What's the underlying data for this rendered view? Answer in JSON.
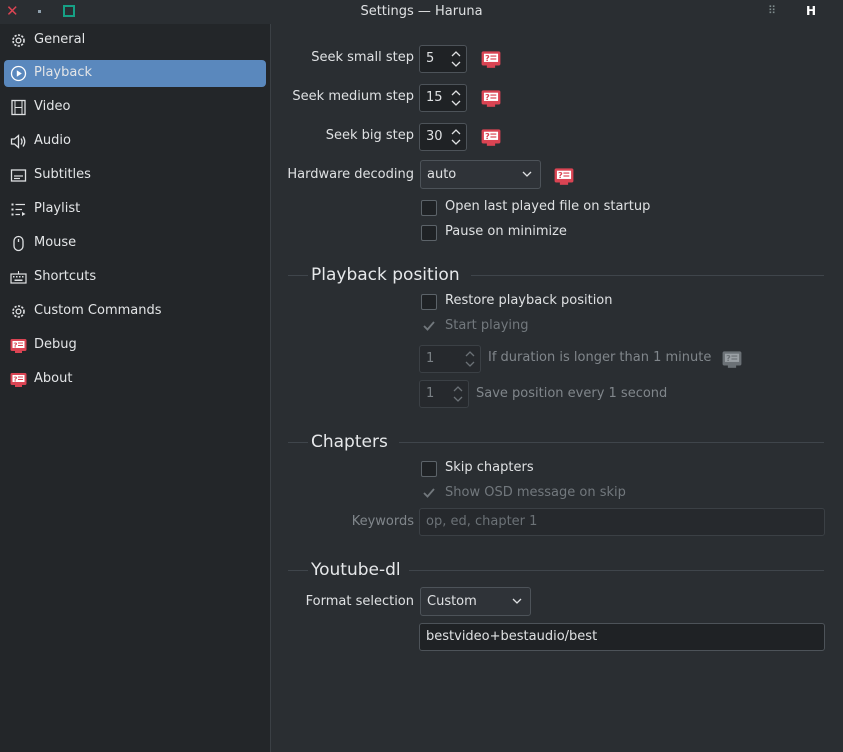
{
  "window": {
    "title": "Settings — Haruna",
    "app_letter": "H",
    "menu_glyph": "⠿"
  },
  "sidebar": {
    "items": [
      {
        "label": "General",
        "icon": "gear-icon"
      },
      {
        "label": "Playback",
        "icon": "play-circle-icon",
        "active": true
      },
      {
        "label": "Video",
        "icon": "film-icon"
      },
      {
        "label": "Audio",
        "icon": "speaker-icon"
      },
      {
        "label": "Subtitles",
        "icon": "subtitles-icon"
      },
      {
        "label": "Playlist",
        "icon": "playlist-icon"
      },
      {
        "label": "Mouse",
        "icon": "mouse-icon"
      },
      {
        "label": "Shortcuts",
        "icon": "keyboard-icon"
      },
      {
        "label": "Custom Commands",
        "icon": "gear-icon"
      },
      {
        "label": "Debug",
        "icon": "help-badge-icon"
      },
      {
        "label": "About",
        "icon": "help-badge-icon"
      }
    ]
  },
  "playback": {
    "seek_small": {
      "label": "Seek small step",
      "value": "5"
    },
    "seek_medium": {
      "label": "Seek medium step",
      "value": "15"
    },
    "seek_big": {
      "label": "Seek big step",
      "value": "30"
    },
    "hw_decoding": {
      "label": "Hardware decoding",
      "value": "auto"
    },
    "open_last": {
      "label": "Open last played file on startup",
      "checked": false
    },
    "pause_minimize": {
      "label": "Pause on minimize",
      "checked": false
    }
  },
  "playback_position": {
    "title": "Playback position",
    "restore": {
      "label": "Restore playback position",
      "checked": false
    },
    "start_playing": {
      "label": "Start playing",
      "checked": true
    },
    "duration": {
      "value": "1",
      "label": "If duration is longer than 1 minute"
    },
    "save_every": {
      "value": "1",
      "label": "Save position every 1 second"
    }
  },
  "chapters": {
    "title": "Chapters",
    "skip": {
      "label": "Skip chapters",
      "checked": false
    },
    "osd": {
      "label": "Show OSD message on skip",
      "checked": true
    },
    "keywords": {
      "label": "Keywords",
      "placeholder": "op, ed, chapter 1"
    }
  },
  "youtube_dl": {
    "title": "Youtube-dl",
    "format": {
      "label": "Format selection",
      "value": "Custom"
    },
    "custom_format": "bestvideo+bestaudio/best"
  },
  "colors": {
    "accent": "#5a88bd",
    "help_icon": "#da4453",
    "close": "#da4453",
    "maximize": "#16a085"
  }
}
